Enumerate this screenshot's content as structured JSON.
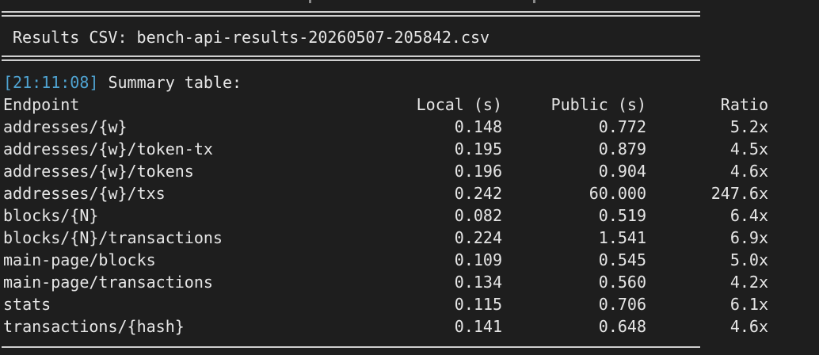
{
  "results_line": {
    "label": "Results CSV:",
    "filename": "bench-api-results-20260507-205842.csv"
  },
  "summary": {
    "timestamp": "[21:11:08]",
    "label": "Summary table:"
  },
  "table": {
    "headers": {
      "endpoint": "Endpoint",
      "local": "Local (s)",
      "public": "Public (s)",
      "ratio": "Ratio"
    },
    "rows": [
      {
        "endpoint": "addresses/{w}",
        "local": "0.148",
        "public": "0.772",
        "ratio": "5.2x"
      },
      {
        "endpoint": "addresses/{w}/token-tx",
        "local": "0.195",
        "public": "0.879",
        "ratio": "4.5x"
      },
      {
        "endpoint": "addresses/{w}/tokens",
        "local": "0.196",
        "public": "0.904",
        "ratio": "4.6x"
      },
      {
        "endpoint": "addresses/{w}/txs",
        "local": "0.242",
        "public": "60.000",
        "ratio": "247.6x"
      },
      {
        "endpoint": "blocks/{N}",
        "local": "0.082",
        "public": "0.519",
        "ratio": "6.4x"
      },
      {
        "endpoint": "blocks/{N}/transactions",
        "local": "0.224",
        "public": "1.541",
        "ratio": "6.9x"
      },
      {
        "endpoint": "main-page/blocks",
        "local": "0.109",
        "public": "0.545",
        "ratio": "5.0x"
      },
      {
        "endpoint": "main-page/transactions",
        "local": "0.134",
        "public": "0.560",
        "ratio": "4.2x"
      },
      {
        "endpoint": "stats",
        "local": "0.115",
        "public": "0.706",
        "ratio": "6.1x"
      },
      {
        "endpoint": "transactions/{hash}",
        "local": "0.141",
        "public": "0.648",
        "ratio": "4.6x"
      }
    ]
  },
  "colors": {
    "background": "#1e1e1e",
    "text": "#e6e6e6",
    "timestamp": "#4fa3d1"
  }
}
